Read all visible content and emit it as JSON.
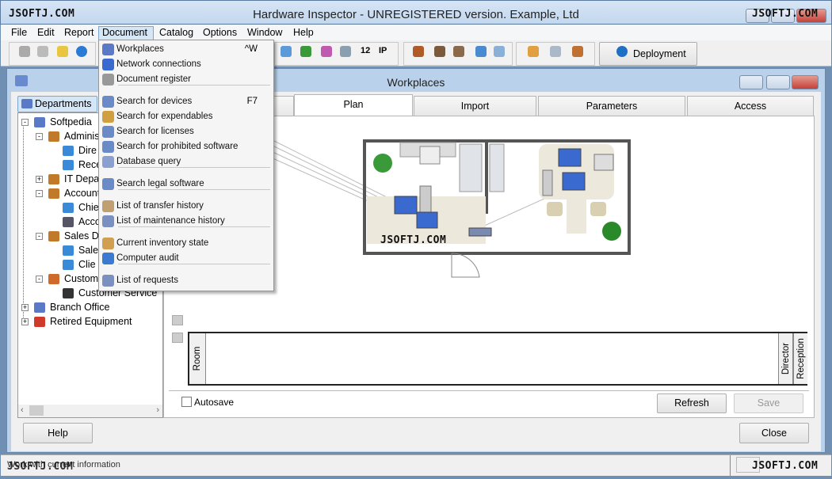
{
  "app": {
    "title": "Hardware Inspector - UNREGISTERED version. Example, Ltd",
    "watermark": "JSOFTJ.COM"
  },
  "menubar": [
    "File",
    "Edit",
    "Report",
    "Document",
    "Catalog",
    "Options",
    "Window",
    "Help"
  ],
  "toolbar": {
    "deployment_label": "Deployment",
    "icons": [
      "server-icon",
      "document-icon",
      "help-icon",
      "info-icon",
      "network-icon",
      "memory-icon",
      "chart-icon",
      "drive-icon",
      "number-icon",
      "ip-icon",
      "user-icon",
      "user-money-icon",
      "user-tools-icon",
      "computer-icon",
      "database-icon",
      "report-icon",
      "screen-icon",
      "tools-icon",
      "globe-icon"
    ],
    "number_label": "12",
    "ip_label": "IP"
  },
  "dropdown": {
    "items": [
      {
        "label": "Workplaces",
        "shortcut": "^W",
        "icon": "workplaces-icon"
      },
      {
        "label": "Network connections",
        "icon": "network-icon"
      },
      {
        "label": "Document register",
        "icon": "register-icon"
      },
      {
        "label": "Search for devices",
        "shortcut": "F7",
        "icon": "search-icon"
      },
      {
        "label": "Search for expendables",
        "icon": "search-icon"
      },
      {
        "label": "Search for licenses",
        "icon": "search-icon"
      },
      {
        "label": "Search for prohibited software",
        "icon": "search-icon"
      },
      {
        "label": "Database query",
        "icon": "magnifier-icon"
      },
      {
        "label": "Search legal software",
        "icon": "search-icon"
      },
      {
        "label": "List of transfer history",
        "icon": "transfer-icon"
      },
      {
        "label": "List of maintenance history",
        "icon": "maintenance-icon"
      },
      {
        "label": "Current inventory state",
        "icon": "inventory-icon"
      },
      {
        "label": "Computer audit",
        "icon": "audit-icon"
      },
      {
        "label": "List of requests",
        "icon": "requests-icon"
      }
    ]
  },
  "child": {
    "title": "Workplaces",
    "departments_label": "Departments",
    "tree": [
      {
        "label": "Softpedia",
        "level": 0,
        "icon": "org-icon"
      },
      {
        "label": "Adminis",
        "level": 1,
        "icon": "group-icon"
      },
      {
        "label": "Dire",
        "level": 2,
        "icon": "computer-icon"
      },
      {
        "label": "Rece",
        "level": 2,
        "icon": "computer-icon"
      },
      {
        "label": "IT Depa",
        "level": 1,
        "icon": "group-icon"
      },
      {
        "label": "Account",
        "level": 1,
        "icon": "group-icon"
      },
      {
        "label": "Chie",
        "level": 2,
        "icon": "computer-icon"
      },
      {
        "label": "Acco",
        "level": 2,
        "icon": "cash-register-icon"
      },
      {
        "label": "Sales D",
        "level": 1,
        "icon": "group-icon"
      },
      {
        "label": "Sale",
        "level": 2,
        "icon": "computer-icon"
      },
      {
        "label": "Clie",
        "level": 2,
        "icon": "computer-icon"
      },
      {
        "label": "Custom",
        "level": 1,
        "icon": "home-icon"
      },
      {
        "label": "Customer Service",
        "level": 2,
        "icon": "terminal-icon"
      },
      {
        "label": "Branch Office",
        "level": 0,
        "icon": "org-icon"
      },
      {
        "label": "Retired Equipment",
        "level": 0,
        "icon": "retired-icon"
      }
    ],
    "tabs": [
      {
        "label": "",
        "active": false
      },
      {
        "label": "Plan",
        "active": true
      },
      {
        "label": "Import",
        "active": false
      },
      {
        "label": "Parameters",
        "active": false
      },
      {
        "label": "Access",
        "active": false
      }
    ],
    "grid_columns": {
      "left": "Room",
      "right": [
        "Director",
        "Reception"
      ]
    },
    "autosave_label": "Autosave",
    "autosave_checked": false,
    "refresh_label": "Refresh",
    "save_label": "Save",
    "help_label": "Help",
    "close_label": "Close"
  },
  "status": {
    "text": "Work with current information"
  }
}
